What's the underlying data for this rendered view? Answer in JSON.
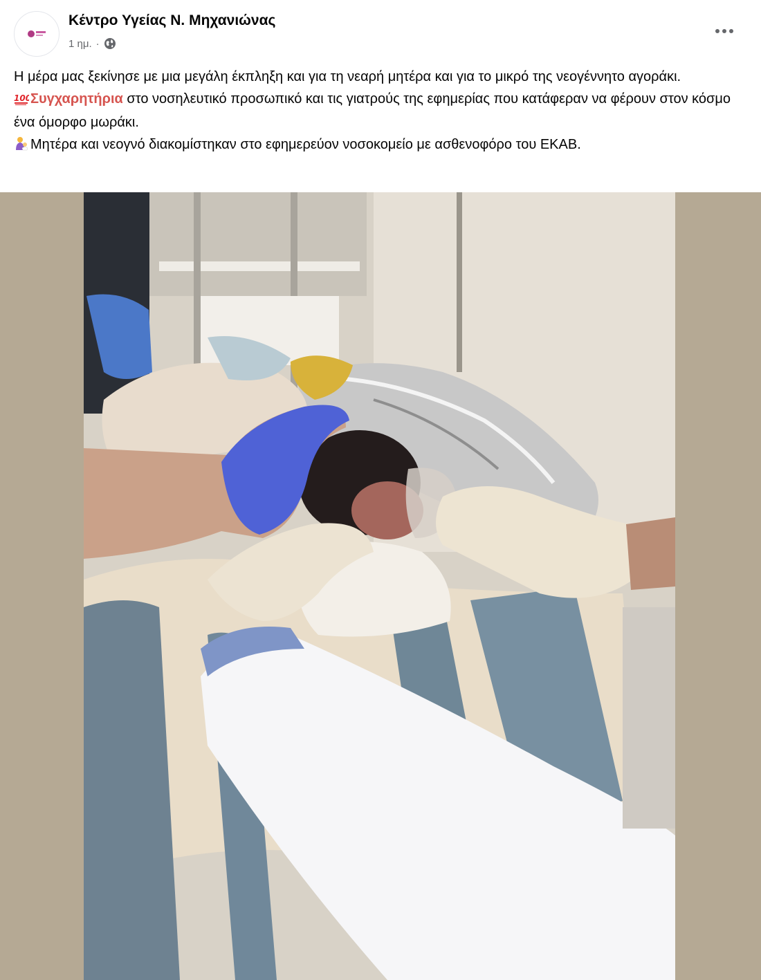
{
  "header": {
    "page_name": "Κέντρο Υγείας Ν. Μηχανιώνας",
    "time": "1 ημ.",
    "separator": "·",
    "audience_icon": "globe-icon",
    "more_icon": "more-options-icon"
  },
  "post": {
    "line1": "Η μέρα μας ξεκίνησε με μια μεγάλη έκπληξη και για τη νεαρή μητέρα και για το μικρό της νεογέννητο αγοράκι.",
    "line2_emoji": "hundred-points-icon",
    "line2_highlight": "Συγχαρητήρια",
    "line2_rest": " στο νοσηλευτικό προσωπικό και τις γιατρούς της εφημερίας που κατάφεραν να φέρουν στον κόσμο ένα όμορφο μωράκι.",
    "line3_emoji": "person-feeding-baby-icon",
    "line3_text": "Μητέρα και νεογνό διακομίστηκαν στο εφημερεύον νοσοκομείο με ασθενοφόρο του ΕΚΑΒ."
  },
  "colors": {
    "highlight": "#d6544f",
    "meta": "#65676b",
    "photo_background": "#b7ab97"
  }
}
